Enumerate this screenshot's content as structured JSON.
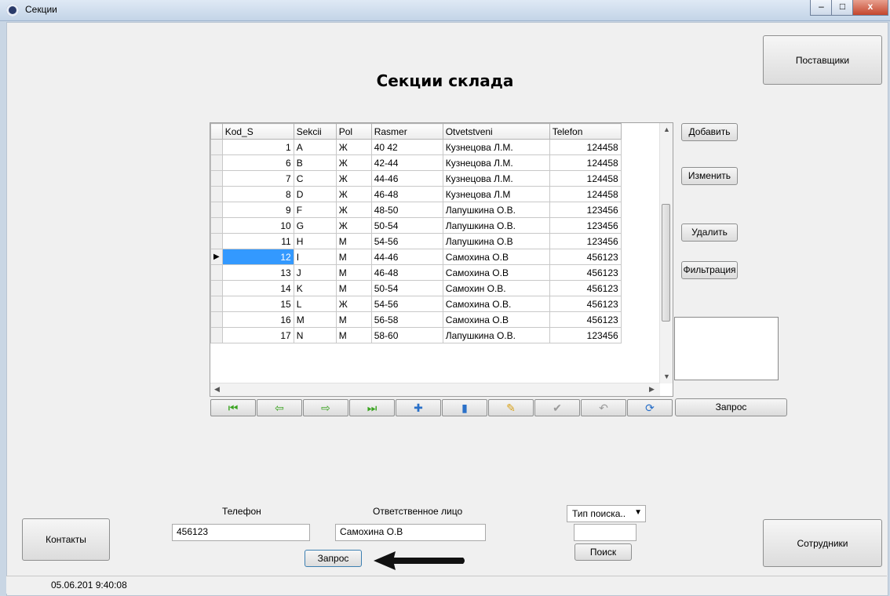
{
  "window": {
    "title": "Секции",
    "minimize": "–",
    "maximize": "□",
    "close": "x"
  },
  "heading": "Секции склада",
  "buttons": {
    "suppliers": "Поставщики",
    "add": "Добавить",
    "edit": "Изменить",
    "delete": "Удалить",
    "filter": "Фильтрация",
    "query_nav": "Запрос",
    "contacts": "Контакты",
    "employees": "Сотрудники",
    "query_bottom": "Запрос",
    "search": "Поиск"
  },
  "grid": {
    "columns": [
      "Kod_S",
      "Sekcii",
      "Pol",
      "Rasmer",
      "Otvetstveni",
      "Telefon"
    ],
    "rows": [
      [
        "1",
        "A",
        "Ж",
        "40 42",
        "Кузнецова Л.М.",
        "124458"
      ],
      [
        "6",
        "B",
        "Ж",
        "42-44",
        "Кузнецова Л.М.",
        "124458"
      ],
      [
        "7",
        "C",
        "Ж",
        "44-46",
        "Кузнецова Л.М.",
        "124458"
      ],
      [
        "8",
        "D",
        "Ж",
        "46-48",
        "Кузнецова Л.М",
        "124458"
      ],
      [
        "9",
        "F",
        "Ж",
        "48-50",
        "Лапушкина О.В.",
        "123456"
      ],
      [
        "10",
        "G",
        "Ж",
        "50-54",
        "Лапушкина О.В.",
        "123456"
      ],
      [
        "11",
        "H",
        "M",
        "54-56",
        "Лапушкина О.В",
        "123456"
      ],
      [
        "12",
        "I",
        "M",
        "44-46",
        "Самохина О.В",
        "456123"
      ],
      [
        "13",
        "J",
        "M",
        "46-48",
        "Самохина О.В",
        "456123"
      ],
      [
        "14",
        "K",
        "M",
        "50-54",
        "Самохин О.В.",
        "456123"
      ],
      [
        "15",
        "L",
        "Ж",
        "54-56",
        "Самохина О.В.",
        "456123"
      ],
      [
        "16",
        "M",
        "M",
        "56-58",
        "Самохина О.В",
        "456123"
      ],
      [
        "17",
        "N",
        "M",
        "58-60",
        "Лапушкина О.В.",
        "123456"
      ]
    ],
    "selected_row": 7,
    "record_indicator": "▶"
  },
  "navigator": [
    {
      "name": "first-record-icon",
      "glyph": "⏮",
      "color": "g"
    },
    {
      "name": "prior-record-icon",
      "glyph": "⇦",
      "color": "g"
    },
    {
      "name": "next-record-icon",
      "glyph": "⇨",
      "color": "g"
    },
    {
      "name": "last-record-icon",
      "glyph": "⏭",
      "color": "g"
    },
    {
      "name": "insert-record-icon",
      "glyph": "✚",
      "color": "b"
    },
    {
      "name": "delete-record-icon",
      "glyph": "▮",
      "color": "b"
    },
    {
      "name": "edit-record-icon",
      "glyph": "✎",
      "color": "o"
    },
    {
      "name": "post-record-icon",
      "glyph": "✔",
      "color": "gr"
    },
    {
      "name": "cancel-record-icon",
      "glyph": "↶",
      "color": "gr"
    },
    {
      "name": "refresh-icon",
      "glyph": "⟳",
      "color": "b"
    }
  ],
  "form": {
    "phone_label": "Телефон",
    "phone_value": "456123",
    "responsible_label": "Ответственное лицо",
    "responsible_value": "Самохина О.В",
    "search_type": "Тип поиска..",
    "search_value": ""
  },
  "status": {
    "datetime": "05.06.201 9:40:08"
  }
}
